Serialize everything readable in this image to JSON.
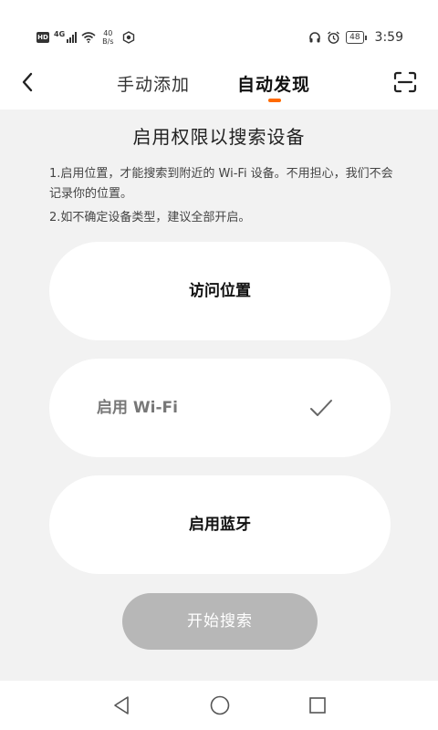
{
  "status_bar": {
    "hd": "HD",
    "network": "4G",
    "speed_value": "40",
    "speed_unit": "B/s",
    "battery": "48",
    "time": "3:59"
  },
  "header": {
    "tabs": [
      {
        "label": "手动添加"
      },
      {
        "label": "自动发现"
      }
    ],
    "active_tab": 1
  },
  "main": {
    "title": "启用权限以搜索设备",
    "desc_1": "1.启用位置，才能搜索到附近的 Wi-Fi 设备。不用担心，我们不会记录你的位置。",
    "desc_2": "2.如不确定设备类型，建议全部开启。",
    "permissions": [
      {
        "label": "访问位置",
        "enabled": false
      },
      {
        "label": "启用 Wi-Fi",
        "enabled": true,
        "icon": "check-icon"
      },
      {
        "label": "启用蓝牙",
        "enabled": false
      }
    ],
    "start_button": "开始搜索"
  },
  "colors": {
    "accent": "#ff6a00",
    "disabled_button": "#b7b7b7",
    "background": "#f2f2f2"
  }
}
